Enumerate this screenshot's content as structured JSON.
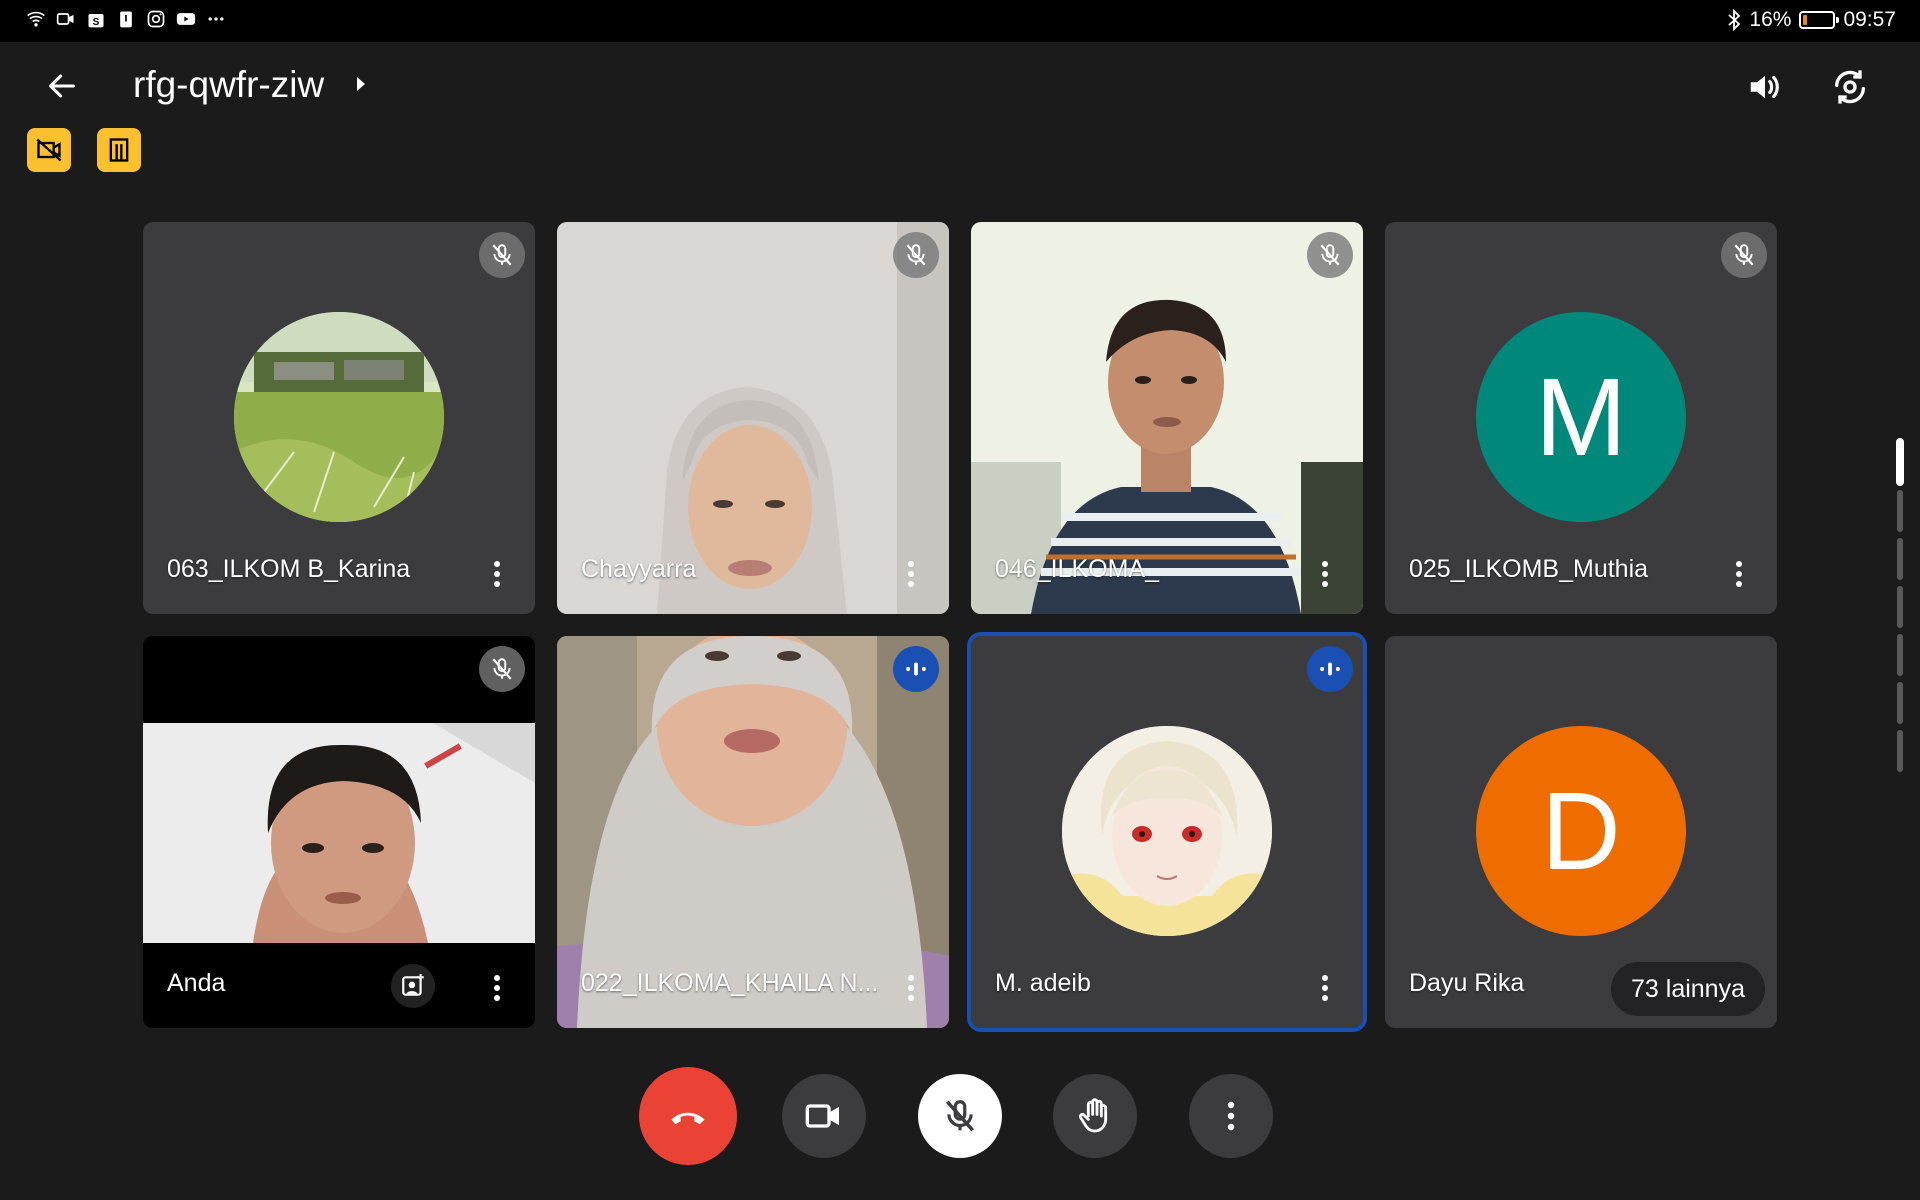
{
  "status_bar": {
    "left_icons": [
      "wifi-icon",
      "video-icon",
      "shop-icon",
      "clipboard-icon",
      "instagram-icon",
      "youtube-icon",
      "more-dots-icon"
    ],
    "bluetooth_icon": "bluetooth-icon",
    "battery_percent": "16%",
    "battery_level": 0.16,
    "time": "09:57"
  },
  "header": {
    "meeting_code": "rfg-qwfr-ziw",
    "back_icon": "arrow-back-icon",
    "volume_icon": "volume-icon",
    "switch_camera_icon": "switch-camera-icon",
    "badges": [
      "no-video-icon",
      "building-icon"
    ]
  },
  "tiles": [
    {
      "name": "063_ILKOM B_Karina",
      "kind": "photo-avatar",
      "mic": "muted"
    },
    {
      "name": "Chayyarra",
      "kind": "video",
      "mic": "muted"
    },
    {
      "name": "046_ILKOMA_",
      "kind": "video",
      "mic": "muted"
    },
    {
      "name": "025_ILKOMB_Muthia",
      "kind": "letter-avatar",
      "letter": "M",
      "color": "#00897b",
      "mic": "muted"
    },
    {
      "name": "Anda",
      "kind": "video",
      "mic": "muted"
    },
    {
      "name": "022_ILKOMA_KHAILA N...",
      "kind": "video",
      "mic": "speaking"
    },
    {
      "name": "M. adeib",
      "kind": "photo-avatar",
      "mic": "speaking",
      "active": true
    },
    {
      "name": "Dayu Rika",
      "kind": "letter-avatar",
      "letter": "D",
      "color": "#ef6c00",
      "more_label": "73 lainnya"
    }
  ],
  "controls": {
    "end_call_icon": "end-call-icon",
    "camera_icon": "video-camera-icon",
    "mic_icon": "mic-off-icon",
    "raise_hand_icon": "raise-hand-icon",
    "more_icon": "more-vert-icon"
  },
  "colors": {
    "background": "#1b1b1b",
    "tile": "#3c3c3e",
    "accent_blue": "#1a4fb3",
    "end_call_red": "#ea4335",
    "badge_yellow": "#fbc02d"
  }
}
